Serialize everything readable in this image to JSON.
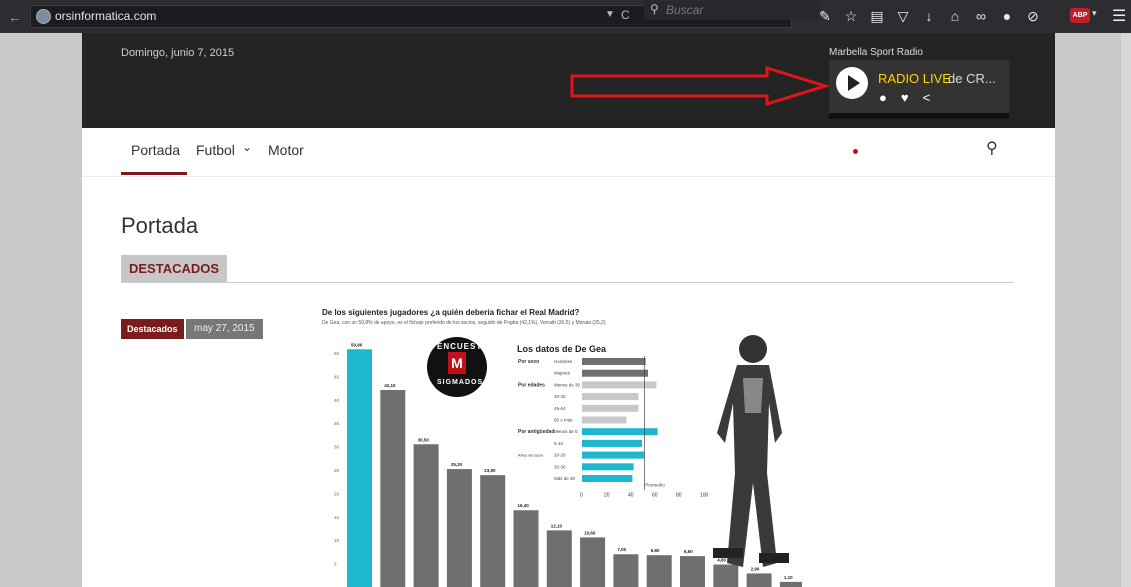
{
  "browser": {
    "url": "orsinformatica.com",
    "search_placeholder": "Buscar",
    "icons": [
      "back-arrow-icon",
      "globe-icon",
      "dropdown-icon",
      "reload-icon",
      "search-icon",
      "wrench-icon",
      "star-icon",
      "reading-list-icon",
      "pocket-icon",
      "download-icon",
      "home-icon",
      "extension-icon",
      "chat-icon",
      "crossed-globe-icon",
      "abp-icon",
      "menu-icon"
    ],
    "abp_label": "ABP"
  },
  "header": {
    "date": "Domingo, junio 7, 2015",
    "radio_title": "Marbella Sport Radio",
    "radio_live": "RADIO LIVE",
    "radio_rest": "de CR..."
  },
  "nav": {
    "items": [
      "Portada",
      "Futbol",
      "Motor"
    ],
    "futbol_caret": "⌄"
  },
  "main": {
    "page_title": "Portada",
    "section": "DESTACADOS",
    "tag": "Destacados",
    "tag_date": "may 27, 2015"
  },
  "infographic": {
    "title": "De los siguientes jugadores ¿a quién debería fichar el Real Madrid?",
    "subtitle": "De Gea, con un 50,8% de apoyo, es el fichaje preferido de los socios, seguido de Pogba (42,1%), Verratti (30,5) y Morata (25,2).",
    "badge_top": "ENCUESTA",
    "badge_m": "M",
    "badge_bottom": "SIGMADOS",
    "stats_title": "Los datos de De Gea",
    "stats_groups": [
      "Por sexo",
      "Por edades",
      "Por antigüedad",
      "Años de socio"
    ],
    "stats_rows": [
      "Hombres",
      "Mujeres",
      "Menos de 30",
      "30-40",
      "45-64",
      "65 o más",
      "Menos de 5",
      "5-10",
      "10-20",
      "20-30",
      "Más de 30"
    ],
    "stats_values": [
      53,
      55,
      62,
      47,
      47,
      37,
      63,
      50,
      52,
      43,
      42
    ],
    "stats_axis": [
      "0",
      "20",
      "40",
      "60",
      "80",
      "100"
    ],
    "promedio": "Promedio",
    "chart_data": {
      "type": "bar",
      "values": [
        50.8,
        42.1,
        30.5,
        25.2,
        23.9,
        16.4,
        12.1,
        10.6,
        7.0,
        6.8,
        6.6,
        4.8,
        2.9,
        1.1
      ],
      "labels": [
        "50,80",
        "42,10",
        "30,50",
        "25,20",
        "23,90",
        "16,40",
        "12,10",
        "10,60",
        "7,00",
        "6,80",
        "6,60",
        "4,80",
        "2,90",
        "1,10"
      ],
      "yticks": [
        "50",
        "45",
        "40",
        "35",
        "30",
        "25",
        "20",
        "15",
        "10",
        "5"
      ],
      "ylim": [
        0,
        50
      ],
      "highlight_index": 0,
      "highlight_color": "#1fb7d0",
      "bar_color": "#6f6f6f"
    }
  }
}
